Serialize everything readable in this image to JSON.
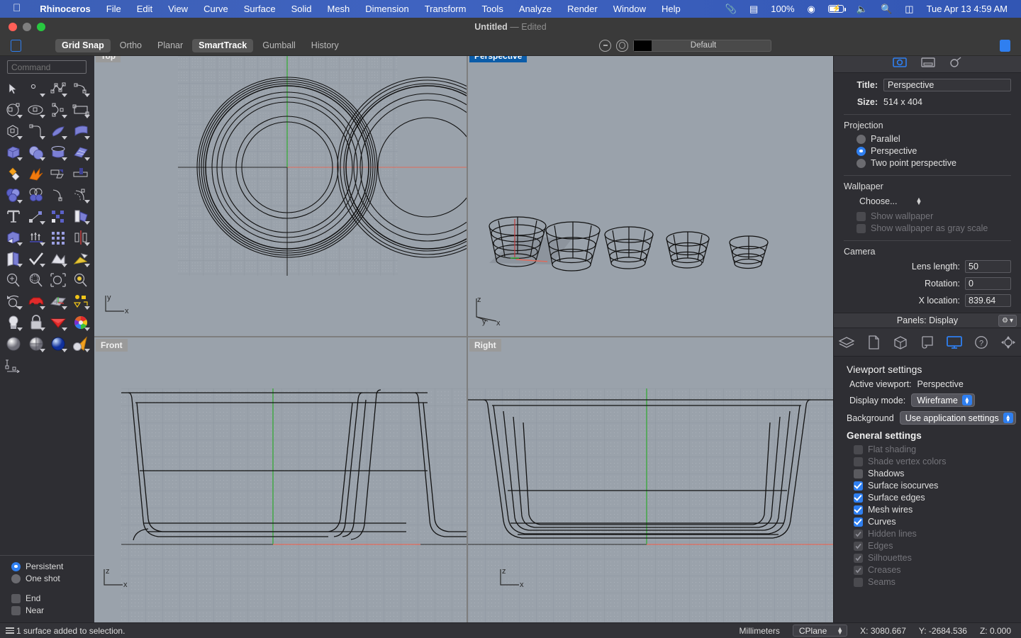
{
  "macmenu": {
    "apple_icon": "apple-logo-icon",
    "items": [
      {
        "label": "Rhinoceros",
        "bold": true
      },
      {
        "label": "File"
      },
      {
        "label": "Edit"
      },
      {
        "label": "View"
      },
      {
        "label": "Curve"
      },
      {
        "label": "Surface"
      },
      {
        "label": "Solid"
      },
      {
        "label": "Mesh"
      },
      {
        "label": "Dimension"
      },
      {
        "label": "Transform"
      },
      {
        "label": "Tools"
      },
      {
        "label": "Analyze"
      },
      {
        "label": "Render"
      },
      {
        "label": "Window"
      },
      {
        "label": "Help"
      }
    ],
    "status_items": [
      {
        "name": "clip-icon",
        "glyph": "✂"
      },
      {
        "name": "display-icon",
        "glyph": "▤"
      },
      {
        "name": "battery-percent",
        "glyph": "100%"
      },
      {
        "name": "play-circle-icon",
        "glyph": "⊙"
      },
      {
        "name": "battery-icon",
        "glyph": ""
      },
      {
        "name": "volume-icon",
        "glyph": "🔊"
      },
      {
        "name": "search-icon",
        "glyph": "🔍"
      },
      {
        "name": "control-center-icon",
        "glyph": "⌸"
      }
    ],
    "clock": "Tue Apr 13  4:59 AM"
  },
  "window": {
    "title": "Untitled",
    "dash": "—",
    "edited": "Edited"
  },
  "toolbar": {
    "modes": [
      {
        "label": "Grid Snap",
        "active": true
      },
      {
        "label": "Ortho",
        "active": false
      },
      {
        "label": "Planar",
        "active": false
      },
      {
        "label": "SmartTrack",
        "active": true
      },
      {
        "label": "Gumball",
        "active": false
      },
      {
        "label": "History",
        "active": false
      }
    ],
    "layer_icon": "layer-target-icon",
    "material_icon": "material-sphere-icon",
    "material_color": "#000000",
    "material_label": "Default",
    "left_panel_toggle": "left-sidebar-toggle-icon",
    "right_panel_toggle": "right-sidebar-toggle-icon"
  },
  "command": {
    "placeholder": "Command",
    "value": ""
  },
  "tool_palette": {
    "rows": [
      [
        "select-arrow-icon",
        "point-icon",
        "polyline-icon",
        "arc-curve-icon"
      ],
      [
        "circle-icon",
        "ellipse-icon",
        "curve-through-points-icon",
        "rectangle-icon"
      ],
      [
        "polygon-icon",
        "fillet-curve-icon",
        "surface-from-curves-icon",
        "extrude-surface-icon"
      ],
      [
        "box-icon",
        "sphere-icon",
        "cylinder-icon",
        "surface-patch-icon"
      ],
      [
        "boolean-union-icon",
        "explode-icon",
        "trim-icon",
        "split-icon"
      ],
      [
        "boolean-difference-icon",
        "boolean-intersection-icon",
        "offset-curve-icon",
        "offset-surface-icon"
      ],
      [
        "text-icon",
        "dimension-icon",
        "array-icon",
        "unroll-icon"
      ],
      [
        "solid-tools-icon",
        "extrude-curve-icon",
        "grid-array-icon",
        "mirror-icon"
      ],
      [
        "book-page-icon",
        "check-mark-icon",
        "mesh-tools-icon",
        "render-mesh-icon"
      ],
      [
        "zoom-in-icon",
        "zoom-window-icon",
        "zoom-extents-icon",
        "zoom-selected-icon"
      ],
      [
        "rotate-view-icon",
        "car-icon",
        "cplane-icon",
        "blocks-icon"
      ],
      [
        "light-bulb-icon",
        "lock-icon",
        "material-icon",
        "color-wheel-icon"
      ],
      [
        "shaded-sphere-icon",
        "rendered-sphere-icon",
        "glossy-sphere-icon",
        "spotlight-icon"
      ],
      [
        "dimension-linear-icon"
      ]
    ]
  },
  "osnap": {
    "mode_options": [
      {
        "label": "Persistent",
        "selected": true
      },
      {
        "label": "One shot",
        "selected": false
      }
    ],
    "snaps": [
      {
        "label": "End",
        "checked": false
      },
      {
        "label": "Near",
        "checked": false
      }
    ]
  },
  "viewports": [
    {
      "name": "Top",
      "label": "Top",
      "active": false,
      "axes": [
        "y",
        "x"
      ]
    },
    {
      "name": "Perspective",
      "label": "Perspective",
      "active": true,
      "axes": [
        "z",
        "y",
        "x"
      ]
    },
    {
      "name": "Front",
      "label": "Front",
      "active": false,
      "axes": [
        "z",
        "x"
      ]
    },
    {
      "name": "Right",
      "label": "Right",
      "active": false,
      "axes": [
        "z",
        "x"
      ]
    }
  ],
  "properties": {
    "tab_icons": [
      "viewport-properties-icon",
      "object-properties-icon",
      "light-properties-icon"
    ],
    "title_label": "Title:",
    "title_value": "Perspective",
    "size_label": "Size:",
    "size_value": "514 x 404",
    "projection_heading": "Projection",
    "projection_options": [
      {
        "label": "Parallel",
        "selected": false
      },
      {
        "label": "Perspective",
        "selected": true
      },
      {
        "label": "Two point perspective",
        "selected": false
      }
    ],
    "wallpaper_heading": "Wallpaper",
    "wallpaper_choose": "Choose...",
    "wallpaper_checks": [
      {
        "label": "Show wallpaper",
        "checked": false,
        "disabled": true
      },
      {
        "label": "Show wallpaper as gray scale",
        "checked": false,
        "disabled": true
      }
    ],
    "camera_heading": "Camera",
    "camera_fields": [
      {
        "label": "Lens length:",
        "value": "50"
      },
      {
        "label": "Rotation:",
        "value": "0"
      },
      {
        "label": "X location:",
        "value": "839.64"
      }
    ]
  },
  "display_panel": {
    "header": "Panels: Display",
    "gear_icon": "gear-icon",
    "chevron_icon": "chevron-down-icon",
    "panel_icons": [
      "layers-icon",
      "notes-icon",
      "properties-cube-icon",
      "rendering-icon",
      "display-monitor-icon",
      "help-icon",
      "named-views-icon"
    ],
    "active_panel_index": 4,
    "viewport_settings_title": "Viewport settings",
    "active_viewport_label": "Active viewport:",
    "active_viewport_value": "Perspective",
    "display_mode_label": "Display mode:",
    "display_mode_value": "Wireframe",
    "background_label": "Background",
    "background_value": "Use application settings",
    "general_settings_title": "General settings",
    "general_settings": [
      {
        "label": "Flat shading",
        "checked": false,
        "disabled": true
      },
      {
        "label": "Shade vertex colors",
        "checked": false,
        "disabled": true
      },
      {
        "label": "Shadows",
        "checked": false,
        "disabled": false
      },
      {
        "label": "Surface isocurves",
        "checked": true,
        "disabled": false
      },
      {
        "label": "Surface edges",
        "checked": true,
        "disabled": false
      },
      {
        "label": "Mesh wires",
        "checked": true,
        "disabled": false
      },
      {
        "label": "Curves",
        "checked": true,
        "disabled": false
      },
      {
        "label": "Hidden lines",
        "checked": true,
        "disabled": true
      },
      {
        "label": "Edges",
        "checked": true,
        "disabled": true
      },
      {
        "label": "Silhouettes",
        "checked": true,
        "disabled": true
      },
      {
        "label": "Creases",
        "checked": true,
        "disabled": true
      },
      {
        "label": "Seams",
        "checked": false,
        "disabled": true
      }
    ]
  },
  "statusbar": {
    "menu_icon": "hamburger-icon",
    "message": "1 surface added to selection.",
    "units": "Millimeters",
    "cplane": "CPlane",
    "x": "X: 3080.667",
    "y": "Y: -2684.536",
    "z": "Z: 0.000"
  },
  "colors": {
    "accent": "#2f7ff0",
    "viewport_bg": "#9aa2ab",
    "panel_bg": "#2e2e33",
    "active_vp_label": "#0b5ca8"
  }
}
